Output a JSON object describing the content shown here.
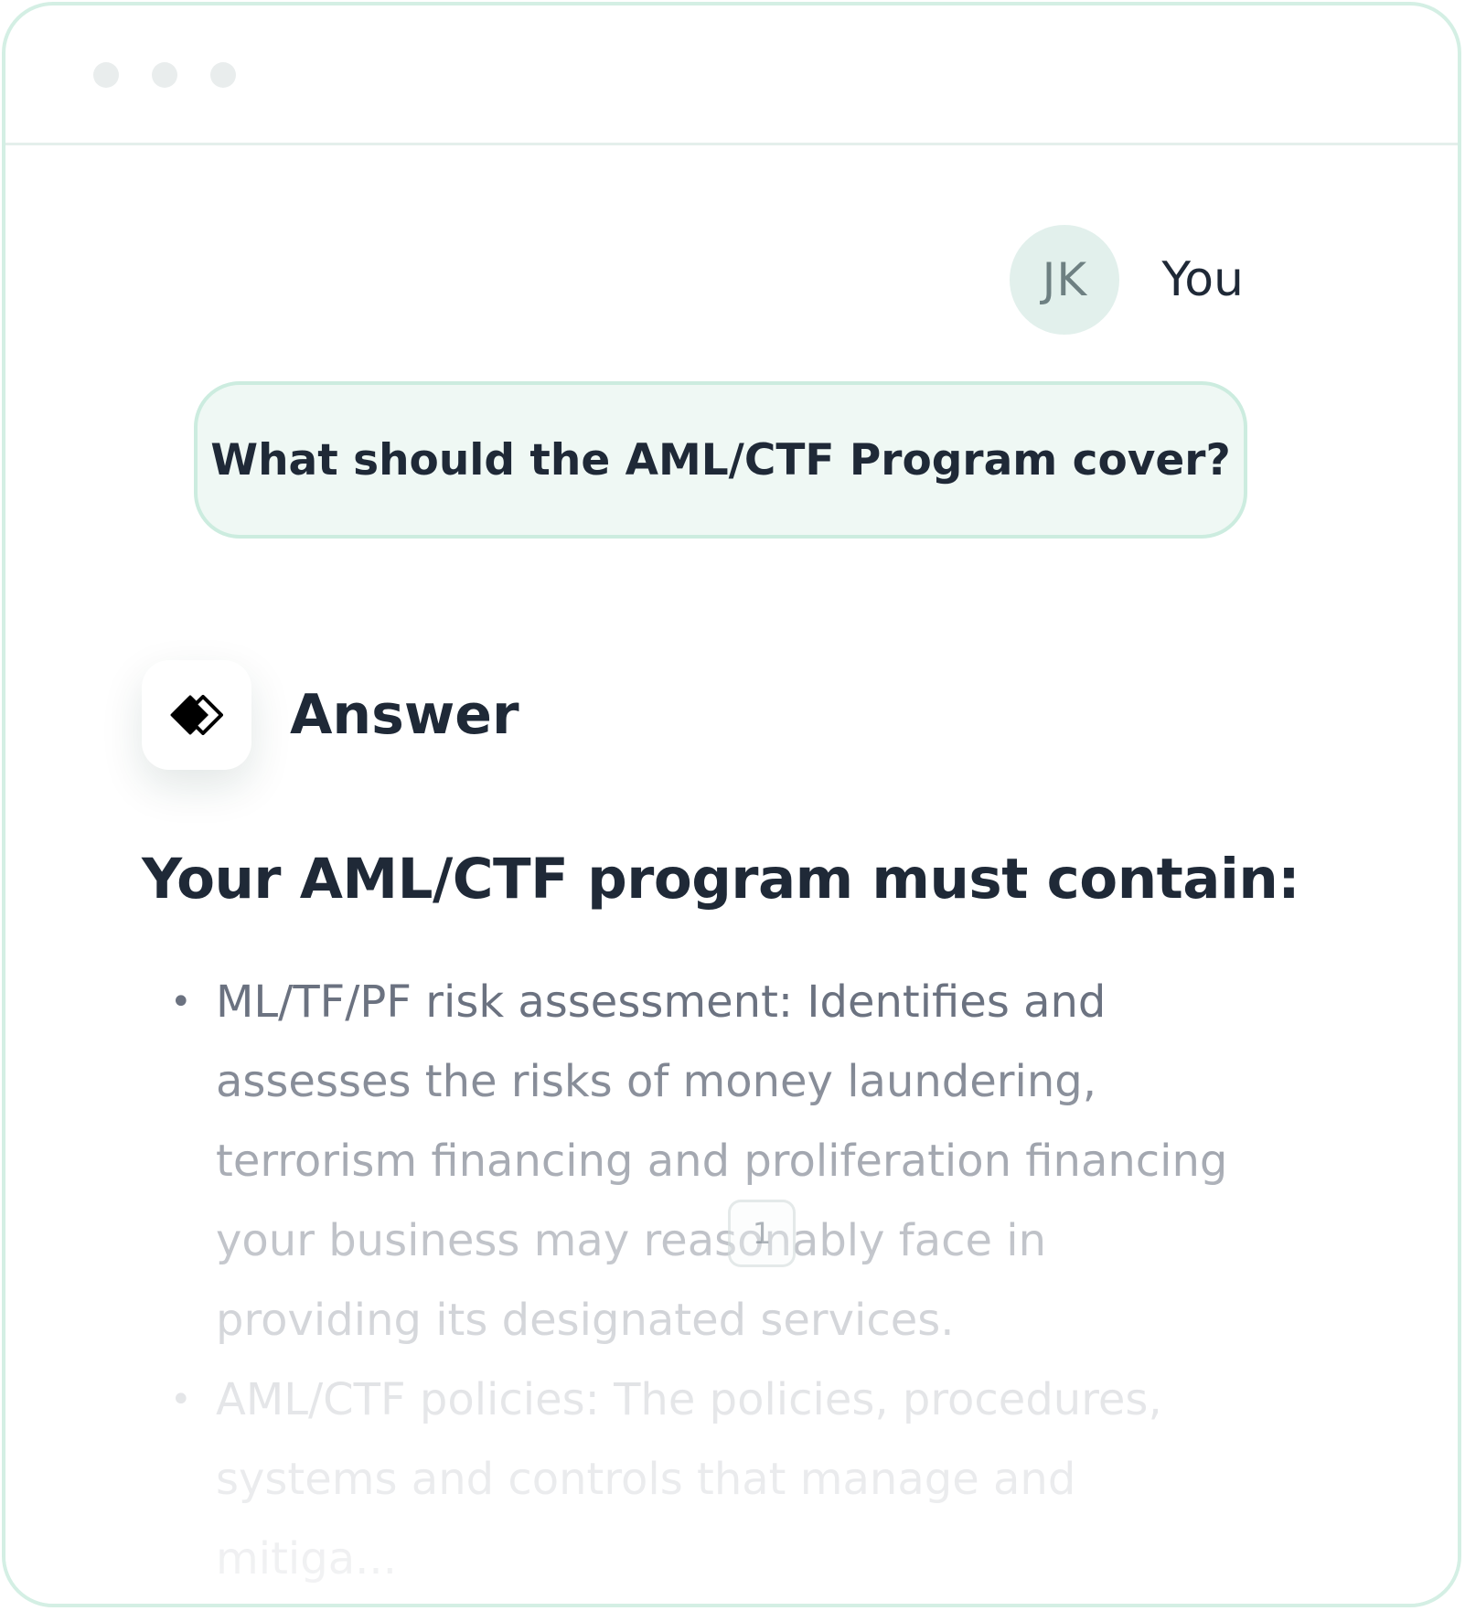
{
  "window": {
    "controls": [
      "dot",
      "dot",
      "dot"
    ]
  },
  "user": {
    "initials": "JK",
    "label": "You"
  },
  "question": {
    "text": "What should the AML/CTF Program cover?"
  },
  "answer": {
    "icon": "diamond-logo-icon",
    "title": "Answer",
    "heading": "Your AML/CTF program must contain:",
    "bullet_glyph": "•",
    "items": [
      {
        "text": "ML/TF/PF risk assessment: Identifies and assesses the risks of money laundering, terrorism financing and proliferation financing your business may reasonably face in providing its designated services."
      },
      {
        "text": "AML/CTF policies: The policies, procedures, systems and controls that manage and mitiga..."
      }
    ],
    "citation": "1"
  },
  "colors": {
    "border": "#d4efe4",
    "bubble_bg": "#eff8f4",
    "avatar_bg": "#e2f0ec",
    "text_dark": "#1f2937",
    "text_muted": "#6b7280"
  }
}
